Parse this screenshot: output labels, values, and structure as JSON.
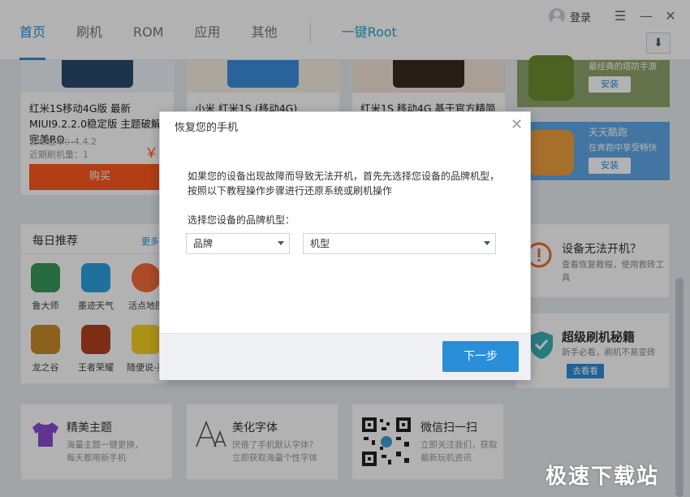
{
  "header": {
    "tabs": [
      {
        "label": "首页",
        "active": true
      },
      {
        "label": "刷机"
      },
      {
        "label": "ROM"
      },
      {
        "label": "应用"
      },
      {
        "label": "其他"
      }
    ],
    "root_tab": "一键Root",
    "login_label": "登录",
    "menu_icon": "menu-icon",
    "minimize_icon": "minimize-icon",
    "close_icon": "close-icon",
    "download_icon": "download-icon"
  },
  "roms": [
    {
      "title": "红米1S移动4G版 最新MIUI9.2.2.0稳定版 主题破解 完美RO...",
      "android_version": "安卓版本：4.4.2",
      "recent_flashes": "近期刷机量：1",
      "price": "￥6",
      "buy_label": "购买"
    },
    {
      "title": "小米 红米1S (移动4G) Funtou"
    },
    {
      "title": "红米1S 移动4G 基于官方精简"
    }
  ],
  "games": [
    {
      "name": "",
      "desc": "最经典的塔防手游",
      "install_label": "安装"
    },
    {
      "name": "天天酷跑",
      "desc": "在奔跑中享受畅快",
      "install_label": "安装"
    }
  ],
  "daily": {
    "title": "每日推荐",
    "more": "更多",
    "apps": [
      {
        "name": "鲁大师"
      },
      {
        "name": "墨迹天气"
      },
      {
        "name": "活点地图"
      },
      {
        "name": "龙之谷"
      },
      {
        "name": "王者荣耀"
      },
      {
        "name": "随便说-英"
      }
    ]
  },
  "side": {
    "cant_boot_title": "设备无法开机？",
    "cant_boot_desc": "查看恢复教程，使用救砖工具",
    "secrets_title": "超级刷机秘籍",
    "secrets_desc": "新手必看，刷机不易变砖",
    "secrets_btn": "去看看"
  },
  "features": [
    {
      "title": "精美主题",
      "desc1": "海量主题一键更换，",
      "desc2": "每天都用新手机"
    },
    {
      "title": "美化字体",
      "desc1": "厌倦了手机默认字体？",
      "desc2": "立即获取海量个性字体"
    },
    {
      "title": "微信扫一扫",
      "desc1": "立即关注我们，获取",
      "desc2": "最新玩机资讯"
    }
  ],
  "dialog": {
    "title": "恢复您的手机",
    "text1": "如果您的设备出现故障而导致无法开机，首先先选择您设备的品牌机型，",
    "text2": "按照以下教程操作步骤进行还原系统或刷机操作",
    "select_label": "选择您设备的品牌机型：",
    "brand_value": "品牌",
    "model_value": "机型",
    "next_label": "下一步"
  },
  "watermark": "极速下载站",
  "colors": {
    "accent": "#2a8ed9",
    "buy": "#ff5a1f",
    "root": "#24a9c9"
  }
}
